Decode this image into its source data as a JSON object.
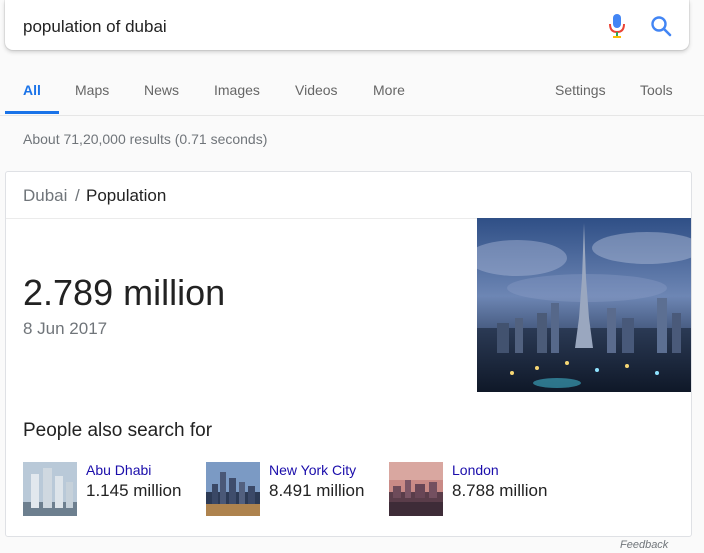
{
  "search": {
    "query": "population of dubai"
  },
  "tabs": [
    {
      "label": "All",
      "active": true
    },
    {
      "label": "Maps"
    },
    {
      "label": "News"
    },
    {
      "label": "Images"
    },
    {
      "label": "Videos"
    },
    {
      "label": "More"
    },
    {
      "label": "Settings"
    },
    {
      "label": "Tools"
    }
  ],
  "results_stats": "About 71,20,000 results (0.71 seconds)",
  "knowledge_card": {
    "breadcrumb_parent": "Dubai",
    "breadcrumb_separator": "/",
    "breadcrumb_current": "Population",
    "value": "2.789 million",
    "date": "8 Jun 2017",
    "people_also_search_title": "People also search for",
    "people_also_search": [
      {
        "name": "Abu Dhabi",
        "value": "1.145 million"
      },
      {
        "name": "New York City",
        "value": "8.491 million"
      },
      {
        "name": "London",
        "value": "8.788 million"
      }
    ]
  },
  "feedback_label": "Feedback",
  "colors": {
    "accent_blue": "#1a73e8",
    "link": "#1a0dab",
    "muted": "#70757a"
  },
  "icons": [
    "microphone-icon",
    "search-icon"
  ]
}
